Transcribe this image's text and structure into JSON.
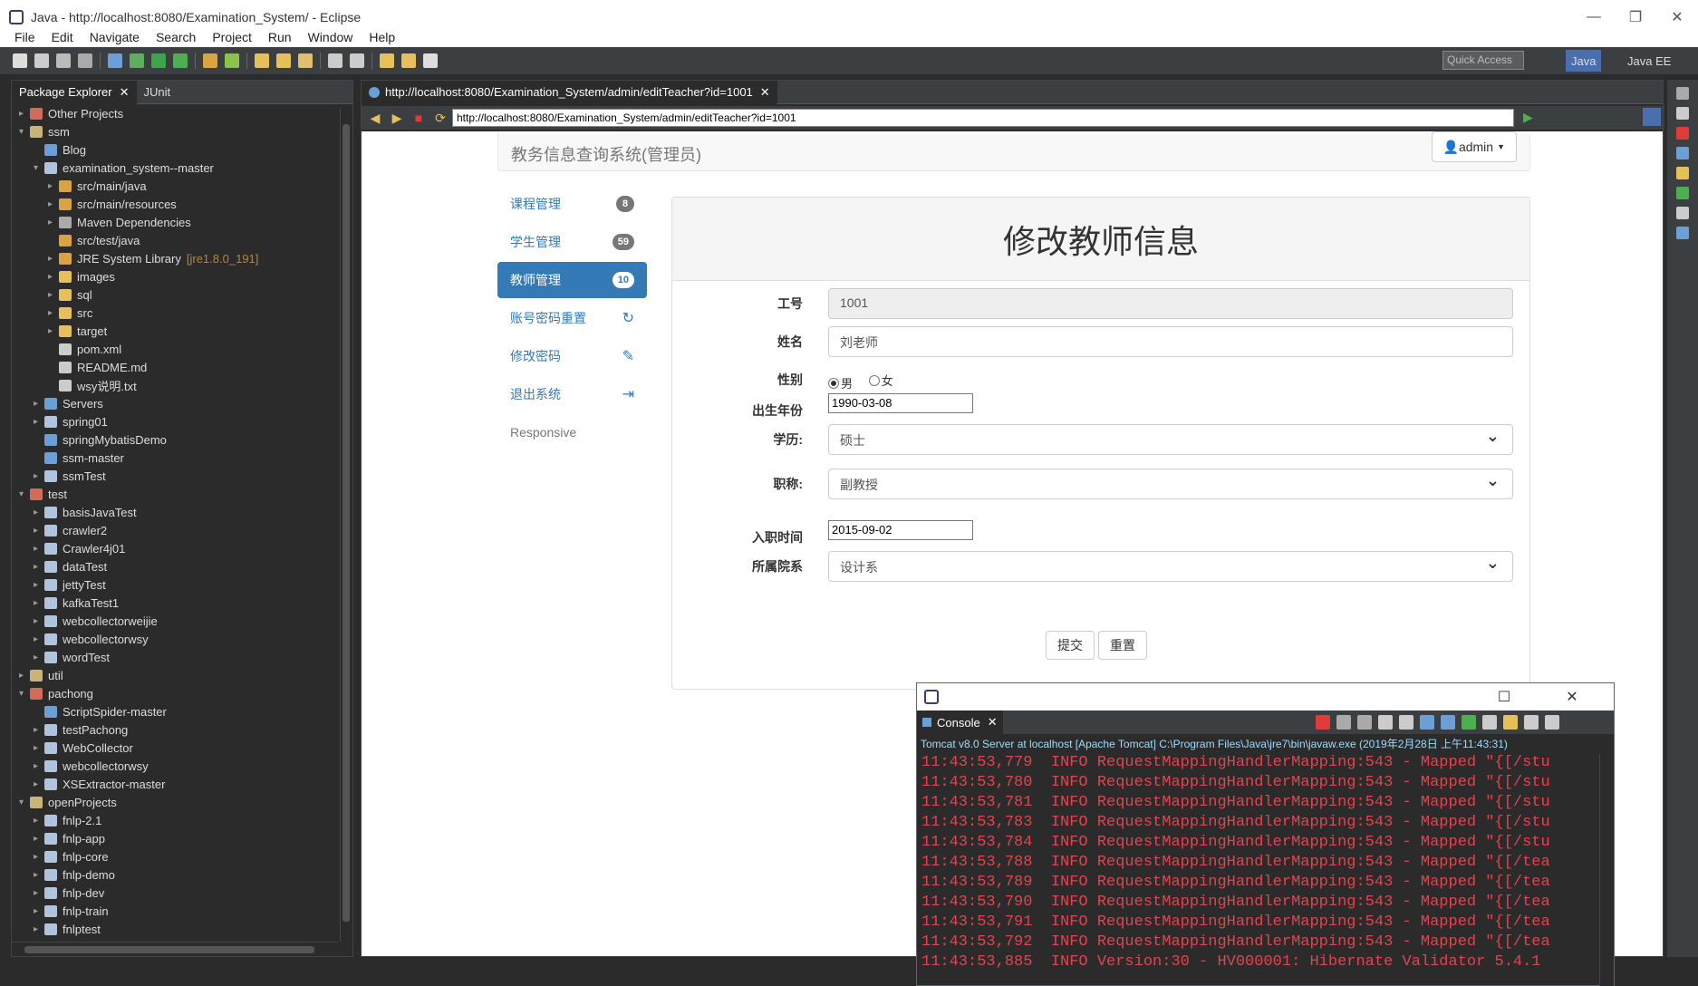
{
  "window": {
    "title": "Java - http://localhost:8080/Examination_System/ - Eclipse",
    "minimize": "—",
    "restore": "❐",
    "close": "✕"
  },
  "menu": [
    "File",
    "Edit",
    "Navigate",
    "Search",
    "Project",
    "Run",
    "Window",
    "Help"
  ],
  "toolbar": {
    "quick_access": "Quick Access",
    "perspective_java": "Java",
    "perspective_javaee": "Java EE"
  },
  "explorer": {
    "tab_label": "Package Explorer",
    "tab_junit": "JUnit",
    "tree": [
      {
        "label": "Other Projects",
        "level": 0,
        "arrow": "▸",
        "color": "#d46a5c"
      },
      {
        "label": "ssm",
        "level": 0,
        "arrow": "▾",
        "color": "#c8b37a"
      },
      {
        "label": "Blog",
        "level": 1,
        "arrow": "",
        "color": "#6b9fd6"
      },
      {
        "label": "examination_system--master",
        "level": 1,
        "arrow": "▾",
        "color": "#b0c4de"
      },
      {
        "label": "src/main/java",
        "level": 2,
        "arrow": "▸",
        "color": "#d9a441"
      },
      {
        "label": "src/main/resources",
        "level": 2,
        "arrow": "▸",
        "color": "#d9a441"
      },
      {
        "label": "Maven Dependencies",
        "level": 2,
        "arrow": "▸",
        "color": "#aaa"
      },
      {
        "label": "src/test/java",
        "level": 2,
        "arrow": "",
        "color": "#d9a441"
      },
      {
        "label": "JRE System Library",
        "level": 2,
        "arrow": "▸",
        "color": "#d9a441",
        "deco": "[jre1.8.0_191]"
      },
      {
        "label": "images",
        "level": 2,
        "arrow": "▸",
        "color": "#e6c15a"
      },
      {
        "label": "sql",
        "level": 2,
        "arrow": "▸",
        "color": "#e6c15a"
      },
      {
        "label": "src",
        "level": 2,
        "arrow": "▸",
        "color": "#e6c15a"
      },
      {
        "label": "target",
        "level": 2,
        "arrow": "▸",
        "color": "#e6c15a"
      },
      {
        "label": "pom.xml",
        "level": 2,
        "arrow": "",
        "color": "#ccc"
      },
      {
        "label": "README.md",
        "level": 2,
        "arrow": "",
        "color": "#ccc"
      },
      {
        "label": "wsy说明.txt",
        "level": 2,
        "arrow": "",
        "color": "#ccc"
      },
      {
        "label": "Servers",
        "level": 1,
        "arrow": "▸",
        "color": "#6b9fd6"
      },
      {
        "label": "spring01",
        "level": 1,
        "arrow": "▸",
        "color": "#b0c4de"
      },
      {
        "label": "springMybatisDemo",
        "level": 1,
        "arrow": "",
        "color": "#6b9fd6"
      },
      {
        "label": "ssm-master",
        "level": 1,
        "arrow": "",
        "color": "#6b9fd6"
      },
      {
        "label": "ssmTest",
        "level": 1,
        "arrow": "▸",
        "color": "#b0c4de"
      },
      {
        "label": "test",
        "level": 0,
        "arrow": "▾",
        "color": "#d46a5c"
      },
      {
        "label": "basisJavaTest",
        "level": 1,
        "arrow": "▸",
        "color": "#b0c4de"
      },
      {
        "label": "crawler2",
        "level": 1,
        "arrow": "▸",
        "color": "#b0c4de"
      },
      {
        "label": "Crawler4j01",
        "level": 1,
        "arrow": "▸",
        "color": "#b0c4de"
      },
      {
        "label": "dataTest",
        "level": 1,
        "arrow": "▸",
        "color": "#b0c4de"
      },
      {
        "label": "jettyTest",
        "level": 1,
        "arrow": "▸",
        "color": "#b0c4de"
      },
      {
        "label": "kafkaTest1",
        "level": 1,
        "arrow": "▸",
        "color": "#b0c4de"
      },
      {
        "label": "webcollectorweijie",
        "level": 1,
        "arrow": "▸",
        "color": "#b0c4de"
      },
      {
        "label": "webcollectorwsy",
        "level": 1,
        "arrow": "▸",
        "color": "#b0c4de"
      },
      {
        "label": "wordTest",
        "level": 1,
        "arrow": "▸",
        "color": "#b0c4de"
      },
      {
        "label": "util",
        "level": 0,
        "arrow": "▸",
        "color": "#c8b37a"
      },
      {
        "label": "pachong",
        "level": 0,
        "arrow": "▾",
        "color": "#d46a5c"
      },
      {
        "label": "ScriptSpider-master",
        "level": 1,
        "arrow": "",
        "color": "#6b9fd6"
      },
      {
        "label": "testPachong",
        "level": 1,
        "arrow": "▸",
        "color": "#b0c4de"
      },
      {
        "label": "WebCollector",
        "level": 1,
        "arrow": "▸",
        "color": "#b0c4de"
      },
      {
        "label": "webcollectorwsy",
        "level": 1,
        "arrow": "▸",
        "color": "#b0c4de"
      },
      {
        "label": "XSExtractor-master",
        "level": 1,
        "arrow": "▸",
        "color": "#b0c4de"
      },
      {
        "label": "openProjects",
        "level": 0,
        "arrow": "▾",
        "color": "#c8b37a"
      },
      {
        "label": "fnlp-2.1",
        "level": 1,
        "arrow": "▸",
        "color": "#b0c4de"
      },
      {
        "label": "fnlp-app",
        "level": 1,
        "arrow": "▸",
        "color": "#b0c4de"
      },
      {
        "label": "fnlp-core",
        "level": 1,
        "arrow": "▸",
        "color": "#b0c4de"
      },
      {
        "label": "fnlp-demo",
        "level": 1,
        "arrow": "▸",
        "color": "#b0c4de"
      },
      {
        "label": "fnlp-dev",
        "level": 1,
        "arrow": "▸",
        "color": "#b0c4de"
      },
      {
        "label": "fnlp-train",
        "level": 1,
        "arrow": "▸",
        "color": "#b0c4de"
      },
      {
        "label": "fnlptest",
        "level": 1,
        "arrow": "▸",
        "color": "#b0c4de"
      }
    ]
  },
  "browser": {
    "tab_label": "http://localhost:8080/Examination_System/admin/editTeacher?id=1001",
    "url": "http://localhost:8080/Examination_System/admin/editTeacher?id=1001"
  },
  "page": {
    "brand": "教务信息查询系统(管理员)",
    "user": "admin",
    "nav": [
      {
        "label": "课程管理",
        "badge": "8",
        "active": false
      },
      {
        "label": "学生管理",
        "badge": "59",
        "active": false
      },
      {
        "label": "教师管理",
        "badge": "10",
        "active": true
      },
      {
        "label": "账号密码重置",
        "icon": "↻",
        "active": false
      },
      {
        "label": "修改密码",
        "icon": "✎",
        "active": false
      },
      {
        "label": "退出系统",
        "icon": "⇥",
        "active": false
      }
    ],
    "nav_footer": "Responsive",
    "form_title": "修改教师信息",
    "fields": {
      "id_label": "工号",
      "id_value": "1001",
      "name_label": "姓名",
      "name_value": "刘老师",
      "gender_label": "性别",
      "gender_male": "男",
      "gender_female": "女",
      "birth_label": "出生年份",
      "birth_value": "1990-03-08",
      "degree_label": "学历:",
      "degree_value": "硕士",
      "title_label": "职称:",
      "title_value": "副教授",
      "hire_label": "入职时间",
      "hire_value": "2015-09-02",
      "dept_label": "所属院系",
      "dept_value": "设计系"
    },
    "submit": "提交",
    "reset": "重置"
  },
  "console": {
    "tab_label": "Console",
    "description": "Tomcat v8.0 Server at localhost [Apache Tomcat] C:\\Program Files\\Java\\jre7\\bin\\javaw.exe (2019年2月28日 上午11:43:31)",
    "lines": [
      "11:43:53,779  INFO RequestMappingHandlerMapping:543 - Mapped \"{[/stu",
      "11:43:53,780  INFO RequestMappingHandlerMapping:543 - Mapped \"{[/stu",
      "11:43:53,781  INFO RequestMappingHandlerMapping:543 - Mapped \"{[/stu",
      "11:43:53,783  INFO RequestMappingHandlerMapping:543 - Mapped \"{[/stu",
      "11:43:53,784  INFO RequestMappingHandlerMapping:543 - Mapped \"{[/stu",
      "11:43:53,788  INFO RequestMappingHandlerMapping:543 - Mapped \"{[/tea",
      "11:43:53,789  INFO RequestMappingHandlerMapping:543 - Mapped \"{[/tea",
      "11:43:53,790  INFO RequestMappingHandlerMapping:543 - Mapped \"{[/tea",
      "11:43:53,791  INFO RequestMappingHandlerMapping:543 - Mapped \"{[/tea",
      "11:43:53,792  INFO RequestMappingHandlerMapping:543 - Mapped \"{[/tea",
      "11:43:53,885  INFO Version:30 - HV000001: Hibernate Validator 5.4.1"
    ]
  },
  "colors": {
    "accent": "#337ab7",
    "ide_bg": "#2b2b2b",
    "console_text": "#e0454e"
  }
}
